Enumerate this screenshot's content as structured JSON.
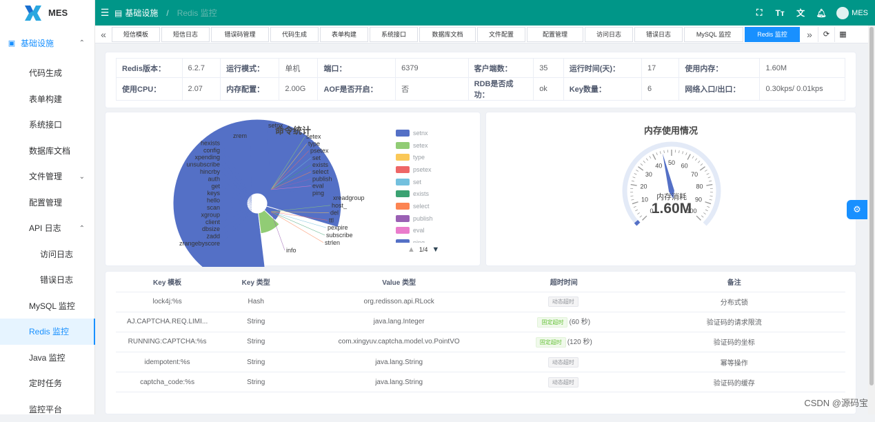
{
  "app": {
    "name": "MES"
  },
  "sidebar": {
    "items": [
      {
        "label": "基础设施",
        "level": "top",
        "arrow": "⌃"
      },
      {
        "label": "代码生成",
        "level": "l1"
      },
      {
        "label": "表单构建",
        "level": "l1"
      },
      {
        "label": "系统接口",
        "level": "l1"
      },
      {
        "label": "数据库文档",
        "level": "l1"
      },
      {
        "label": "文件管理",
        "level": "l1",
        "arrow": "⌄"
      },
      {
        "label": "配置管理",
        "level": "l1"
      },
      {
        "label": "API 日志",
        "level": "l1",
        "arrow": "⌃"
      },
      {
        "label": "访问日志",
        "level": "l2"
      },
      {
        "label": "错误日志",
        "level": "l2"
      },
      {
        "label": "MySQL 监控",
        "level": "l1"
      },
      {
        "label": "Redis 监控",
        "level": "l1",
        "active": true
      },
      {
        "label": "Java 监控",
        "level": "l1"
      },
      {
        "label": "定时任务",
        "level": "l1"
      },
      {
        "label": "监控平台",
        "level": "l1"
      }
    ]
  },
  "header": {
    "breadcrumb": [
      "基础设施",
      "Redis 监控"
    ],
    "user": "MES",
    "colors": {
      "bar": "#009688",
      "accent": "#1890ff"
    }
  },
  "tabs": [
    {
      "label": "短信模板",
      "w": 70
    },
    {
      "label": "短信日志",
      "w": 70
    },
    {
      "label": "错误码管理",
      "w": 84
    },
    {
      "label": "代码生成",
      "w": 70
    },
    {
      "label": "表单构建",
      "w": 70
    },
    {
      "label": "系统接口",
      "w": 70
    },
    {
      "label": "数据库文档",
      "w": 82
    },
    {
      "label": "文件配置",
      "w": 70
    },
    {
      "label": "配置管理",
      "w": 82
    },
    {
      "label": "访问日志",
      "w": 70
    },
    {
      "label": "错误日志",
      "w": 70
    },
    {
      "label": "MySQL 监控",
      "w": 86
    },
    {
      "label": "Redis 监控",
      "w": 80,
      "active": true
    }
  ],
  "info": [
    [
      {
        "k": "Redis版本：",
        "v": "6.2.7"
      },
      {
        "k": "运行模式：",
        "v": "单机"
      },
      {
        "k": "端口：",
        "v": "6379"
      },
      {
        "k": "客户端数：",
        "v": "35"
      },
      {
        "k": "运行时间(天)：",
        "v": "17"
      },
      {
        "k": "使用内存：",
        "v": "1.60M"
      }
    ],
    [
      {
        "k": "使用CPU：",
        "v": "2.07"
      },
      {
        "k": "内存配置：",
        "v": "2.00G"
      },
      {
        "k": "AOF是否开启：",
        "v": "否"
      },
      {
        "k": "RDB是否成功：",
        "v": "ok"
      },
      {
        "k": "Key数量：",
        "v": "6"
      },
      {
        "k": "网络入口/出口：",
        "v": "0.30kps/ 0.01kps"
      }
    ]
  ],
  "charts": {
    "pie_title": "命令统计",
    "gauge_title": "内存使用情况",
    "pager": "1/4",
    "gauge_name": "内存消耗",
    "gauge_value_text": "1.60M"
  },
  "chart_data": [
    {
      "type": "pie",
      "title": "命令统计",
      "rose": true,
      "labels_left": [
        "zrem",
        "hexists",
        "config",
        "xpending",
        "unsubscribe",
        "hincrby",
        "auth",
        "get",
        "keys",
        "hello",
        "scan",
        "xgroup",
        "client",
        "dbsize",
        "zadd",
        "zrangebyscore"
      ],
      "labels_right": [
        "setnx",
        "setex",
        "type",
        "psetex",
        "set",
        "exists",
        "select",
        "publish",
        "eval",
        "ping",
        "xreadgroup",
        "host_",
        "del",
        "ttl",
        "pexpire",
        "subscribe",
        "strlen",
        "info"
      ],
      "slices": [
        {
          "name": "big-blue",
          "value": 88,
          "color": "#5470c6"
        },
        {
          "name": "green",
          "value": 12,
          "color": "#91cc75"
        },
        {
          "name": "small-blue",
          "value": 8,
          "color": "#5470c6"
        }
      ],
      "legend": [
        {
          "name": "setnx",
          "color": "#5470c6"
        },
        {
          "name": "setex",
          "color": "#91cc75"
        },
        {
          "name": "type",
          "color": "#fac858"
        },
        {
          "name": "psetex",
          "color": "#ee6666"
        },
        {
          "name": "set",
          "color": "#73c0de"
        },
        {
          "name": "exists",
          "color": "#3ba272"
        },
        {
          "name": "select",
          "color": "#fc8452"
        },
        {
          "name": "publish",
          "color": "#9a60b4"
        },
        {
          "name": "eval",
          "color": "#ea7ccc"
        },
        {
          "name": "ping",
          "color": "#5470c6"
        }
      ]
    },
    {
      "type": "gauge",
      "title": "内存使用情况",
      "min": 0,
      "max": 100,
      "value": 1.6,
      "ticks": [
        "0",
        "10",
        "20",
        "30",
        "40",
        "50",
        "60",
        "70",
        "80",
        "90",
        "100"
      ]
    }
  ],
  "table": {
    "headers": [
      "Key 模板",
      "Key 类型",
      "Value 类型",
      "超时时间",
      "备注"
    ],
    "rows": [
      {
        "key": "lock4j:%s",
        "type": "Hash",
        "value": "org.redisson.api.RLock",
        "tag": "动态超时",
        "tag_green": false,
        "timeout": "",
        "note": "分布式锁"
      },
      {
        "key": "AJ.CAPTCHA.REQ.LIMI...",
        "type": "String",
        "value": "java.lang.Integer",
        "tag": "固定超时",
        "tag_green": true,
        "timeout": "(60 秒)",
        "note": "验证码的请求限流"
      },
      {
        "key": "RUNNING:CAPTCHA:%s",
        "type": "String",
        "value": "com.xingyuv.captcha.model.vo.PointVO",
        "tag": "固定超时",
        "tag_green": true,
        "timeout": "(120 秒)",
        "note": "验证码的坐标"
      },
      {
        "key": "idempotent:%s",
        "type": "String",
        "value": "java.lang.String",
        "tag": "动态超时",
        "tag_green": false,
        "timeout": "",
        "note": "幂等操作"
      },
      {
        "key": "captcha_code:%s",
        "type": "String",
        "value": "java.lang.String",
        "tag": "动态超时",
        "tag_green": false,
        "timeout": "",
        "note": "验证码的缓存"
      }
    ]
  },
  "watermark": "CSDN @源码宝"
}
